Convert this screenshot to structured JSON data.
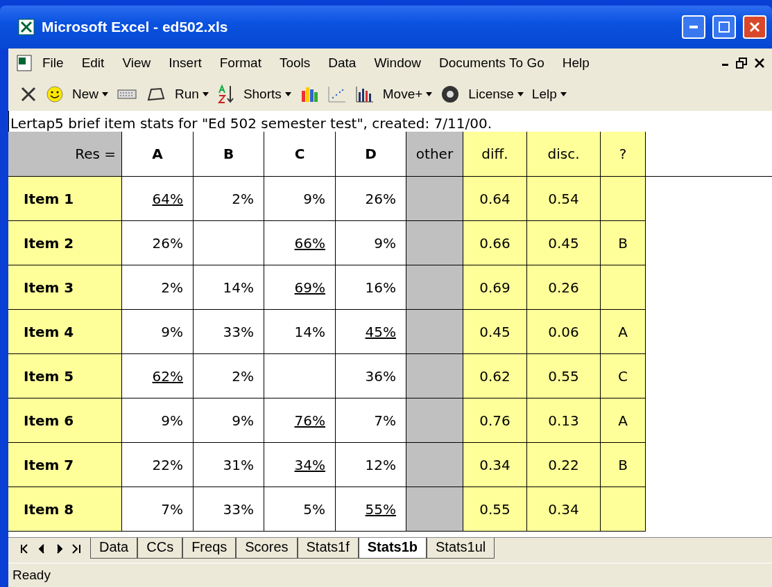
{
  "window": {
    "title": "Microsoft Excel - ed502.xls"
  },
  "menu": [
    "File",
    "Edit",
    "View",
    "Insert",
    "Format",
    "Tools",
    "Data",
    "Window",
    "Documents To Go",
    "Help"
  ],
  "toolbar": [
    {
      "kind": "dropdown",
      "label": "New"
    },
    {
      "kind": "dropdown",
      "label": "Run"
    },
    {
      "kind": "dropdown",
      "label": "Shorts"
    },
    {
      "kind": "dropdown",
      "label": "Move+"
    },
    {
      "kind": "dropdown",
      "label": "License"
    },
    {
      "kind": "dropdown",
      "label": "Lelp"
    }
  ],
  "sheet": {
    "caption": "Lertap5 brief item stats for \"Ed 502 semester test\", created: 7/11/00.",
    "columns": [
      "Res =",
      "A",
      "B",
      "C",
      "D",
      "other",
      "diff.",
      "disc.",
      "?"
    ],
    "rows": [
      {
        "label": "Item 1",
        "options": {
          "a": {
            "text": "64%",
            "correct": true
          },
          "b": {
            "text": "2%",
            "correct": false
          },
          "c": {
            "text": "9%",
            "correct": false
          },
          "d": {
            "text": "26%",
            "correct": false
          }
        },
        "diff": "0.64",
        "disc": "0.54"
      },
      {
        "label": "Item 2",
        "options": {
          "a": {
            "text": "26%",
            "correct": false
          },
          "c": {
            "text": "66%",
            "correct": true
          },
          "d": {
            "text": "9%",
            "correct": false
          }
        },
        "diff": "0.66",
        "disc": "0.45",
        "flag": "B"
      },
      {
        "label": "Item 3",
        "options": {
          "a": {
            "text": "2%",
            "correct": false
          },
          "b": {
            "text": "14%",
            "correct": false
          },
          "c": {
            "text": "69%",
            "correct": true
          },
          "d": {
            "text": "16%",
            "correct": false
          }
        },
        "diff": "0.69",
        "disc": "0.26"
      },
      {
        "label": "Item 4",
        "options": {
          "a": {
            "text": "9%",
            "correct": false
          },
          "b": {
            "text": "33%",
            "correct": false
          },
          "c": {
            "text": "14%",
            "correct": false
          },
          "d": {
            "text": "45%",
            "correct": true
          }
        },
        "diff": "0.45",
        "disc": "0.06",
        "flag": "A"
      },
      {
        "label": "Item 5",
        "options": {
          "a": {
            "text": "62%",
            "correct": true
          },
          "b": {
            "text": "2%",
            "correct": false
          },
          "d": {
            "text": "36%",
            "correct": false
          }
        },
        "diff": "0.62",
        "disc": "0.55",
        "flag": "C"
      },
      {
        "label": "Item 6",
        "options": {
          "a": {
            "text": "9%",
            "correct": false
          },
          "b": {
            "text": "9%",
            "correct": false
          },
          "c": {
            "text": "76%",
            "correct": true
          },
          "d": {
            "text": "7%",
            "correct": false
          }
        },
        "diff": "0.76",
        "disc": "0.13",
        "flag": "A"
      },
      {
        "label": "Item 7",
        "options": {
          "a": {
            "text": "22%",
            "correct": false
          },
          "b": {
            "text": "31%",
            "correct": false
          },
          "c": {
            "text": "34%",
            "correct": true
          },
          "d": {
            "text": "12%",
            "correct": false
          }
        },
        "diff": "0.34",
        "disc": "0.22",
        "flag": "B"
      },
      {
        "label": "Item 8",
        "options": {
          "a": {
            "text": "7%",
            "correct": false
          },
          "b": {
            "text": "33%",
            "correct": false
          },
          "c": {
            "text": "5%",
            "correct": false
          },
          "d": {
            "text": "55%",
            "correct": true
          }
        },
        "diff": "0.55",
        "disc": "0.34"
      }
    ]
  },
  "sheet_tabs": [
    {
      "label": "Data",
      "selected": false
    },
    {
      "label": "CCs",
      "selected": false
    },
    {
      "label": "Freqs",
      "selected": false
    },
    {
      "label": "Scores",
      "selected": false
    },
    {
      "label": "Stats1f",
      "selected": false
    },
    {
      "label": "Stats1b",
      "selected": true
    },
    {
      "label": "Stats1ul",
      "selected": false
    }
  ],
  "status_bar": "Ready"
}
